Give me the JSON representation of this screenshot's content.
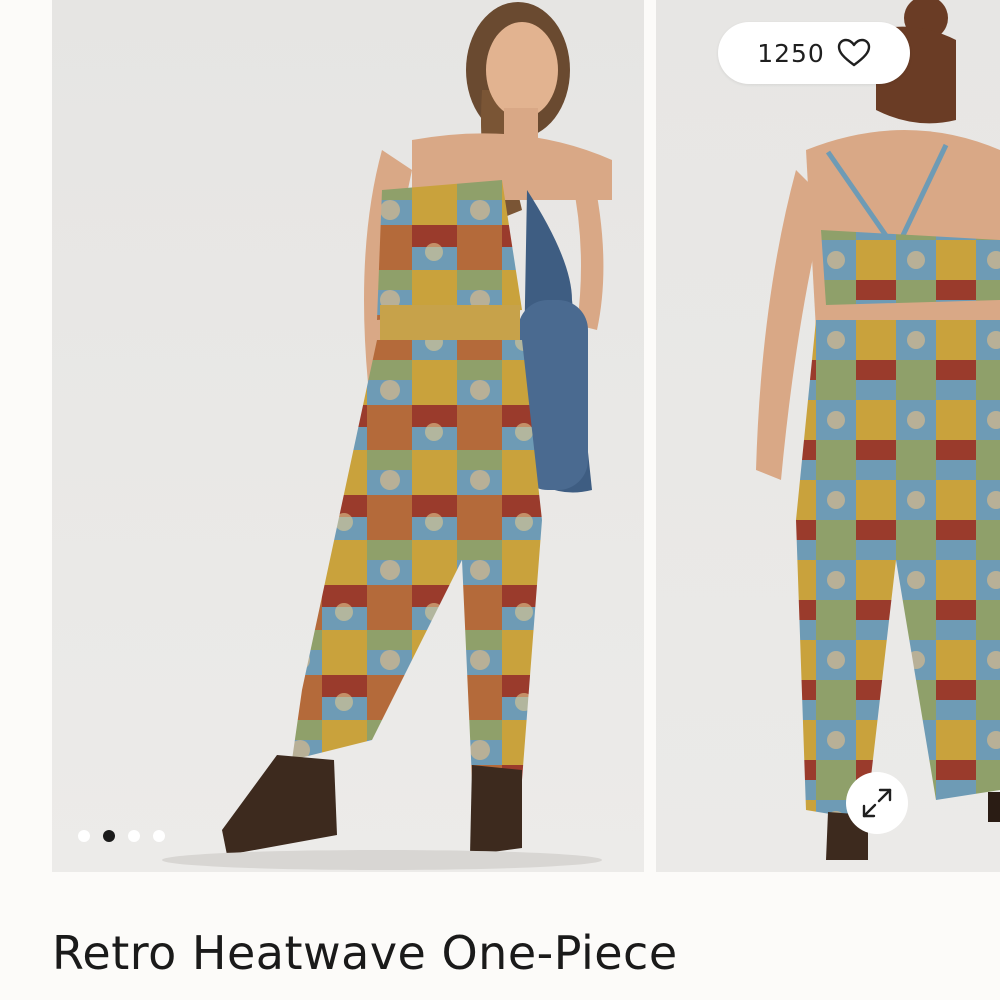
{
  "gallery": {
    "like_count": "1250",
    "like_icon": "heart-outline-icon",
    "expand_icon": "expand-arrows-icon",
    "images": [
      {
        "view": "front"
      },
      {
        "view": "back"
      }
    ],
    "pagination": {
      "total": 4,
      "active_index": 1
    }
  },
  "product": {
    "title": "Retro Heatwave One-Piece"
  },
  "colors": {
    "background": "#fcfbf9",
    "photo_backdrop": "#e9e8e6",
    "text": "#1a1a1a",
    "dot_active": "#1b1b1b",
    "dot_inactive": "#ffffff"
  }
}
